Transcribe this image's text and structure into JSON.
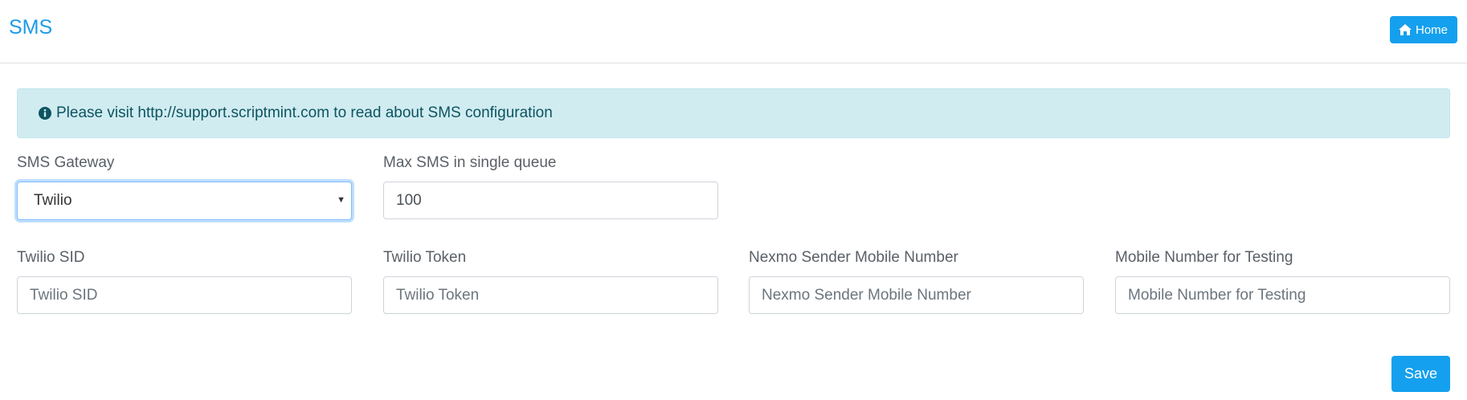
{
  "header": {
    "title": "SMS",
    "home_label": "Home"
  },
  "alert": {
    "text": "Please visit http://support.scriptmint.com to read about SMS configuration"
  },
  "form": {
    "gateway": {
      "label": "SMS Gateway",
      "value": "Twilio"
    },
    "max_sms": {
      "label": "Max SMS in single queue",
      "value": "100"
    },
    "twilio_sid": {
      "label": "Twilio SID",
      "placeholder": "Twilio SID"
    },
    "twilio_token": {
      "label": "Twilio Token",
      "placeholder": "Twilio Token"
    },
    "nexmo_sender": {
      "label": "Nexmo Sender Mobile Number",
      "placeholder": "Nexmo Sender Mobile Number"
    },
    "test_number": {
      "label": "Mobile Number for Testing",
      "placeholder": "Mobile Number for Testing"
    }
  },
  "actions": {
    "save_label": "Save"
  },
  "icons": {
    "home": "home-icon",
    "info": "info-circle-icon",
    "select_caret": "caret-down-icon"
  },
  "colors": {
    "primary": "#14a0ee",
    "title": "#1e9be9",
    "alert_bg": "#d1ecf1",
    "alert_text": "#0c5460"
  }
}
